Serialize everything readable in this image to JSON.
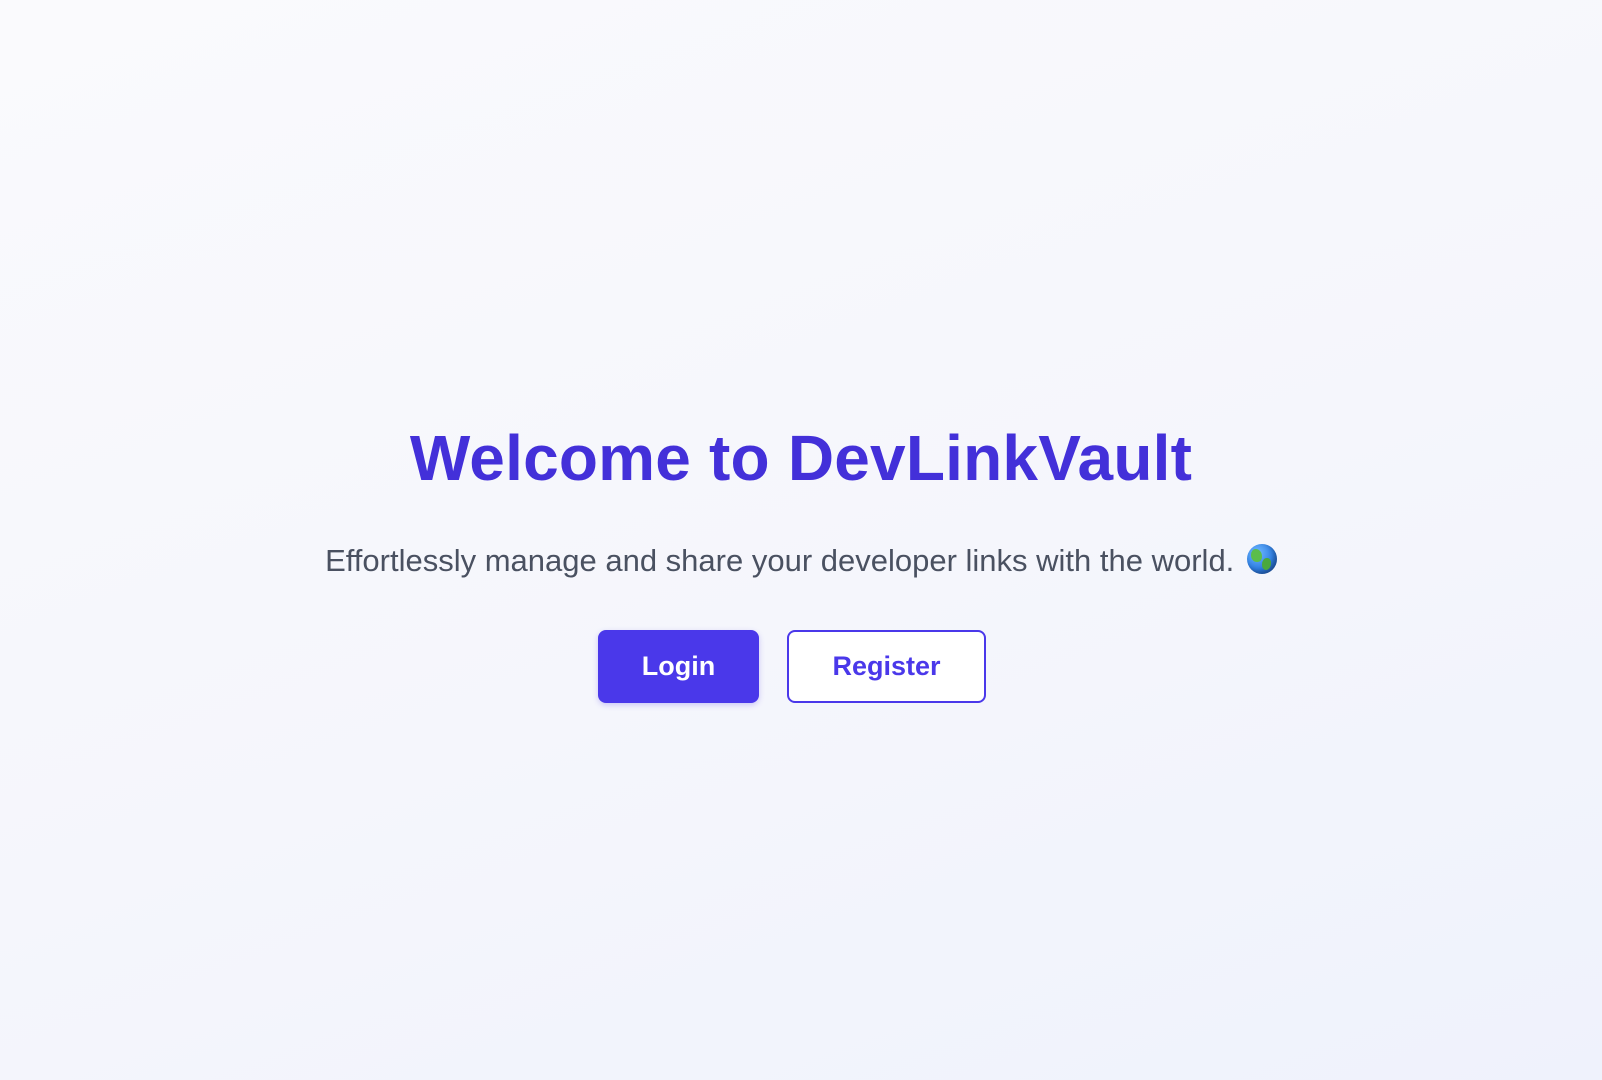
{
  "hero": {
    "title": "Welcome to DevLinkVault",
    "subtitle": "Effortlessly manage and share your developer links with the world.",
    "subtitle_icon": "globe-icon"
  },
  "actions": {
    "login_label": "Login",
    "register_label": "Register"
  },
  "colors": {
    "brand": "#4a38ea",
    "title": "#4330d9",
    "subtitle": "#4a5161",
    "background": "#f5f6fc"
  }
}
